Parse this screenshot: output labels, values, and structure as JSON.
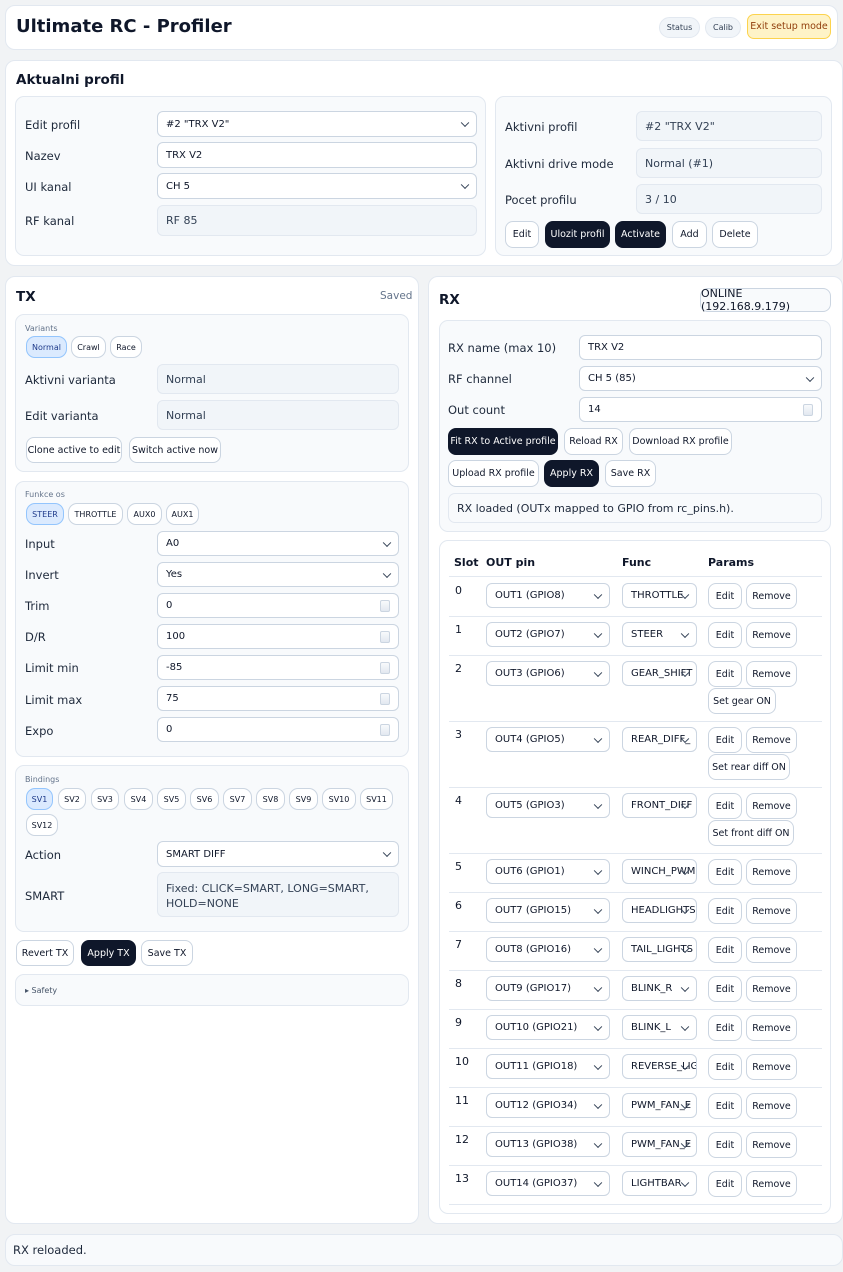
{
  "header": {
    "title": "Ultimate RC - Profiler",
    "badges": [
      "Status",
      "Calib"
    ],
    "exit_label": "Exit setup mode"
  },
  "profile": {
    "section_title": "Aktualni profil",
    "edit_profil_label": "Edit profil",
    "edit_profil_value": "#2 \"TRX V2\"",
    "nazev_label": "Nazev",
    "nazev_value": "TRX V2",
    "ui_kanal_label": "UI kanal",
    "ui_kanal_value": "CH 5",
    "rf_kanal_label": "RF kanal",
    "rf_kanal_value": "RF 85",
    "aktivni_profil_label": "Aktivni profil",
    "aktivni_profil_value": "#2 \"TRX V2\"",
    "drive_mode_label": "Aktivni drive mode",
    "drive_mode_value": "Normal (#1)",
    "pocet_label": "Pocet profilu",
    "pocet_value": "3 / 10",
    "buttons": {
      "edit": "Edit",
      "save": "Ulozit profil",
      "activate": "Activate",
      "add": "Add",
      "delete": "Delete"
    }
  },
  "tx": {
    "title": "TX",
    "saved": "Saved",
    "variants_label": "Variants",
    "variants": [
      "Normal",
      "Crawl",
      "Race"
    ],
    "aktivni_varianta_label": "Aktivni varianta",
    "aktivni_varianta_value": "Normal",
    "edit_varianta_label": "Edit varianta",
    "edit_varianta_value": "Normal",
    "clone_label": "Clone active to edit",
    "switch_label": "Switch active now",
    "funkce_label": "Funkce os",
    "axes": [
      "STEER",
      "THROTTLE",
      "AUX0",
      "AUX1"
    ],
    "fields": {
      "input": {
        "label": "Input",
        "value": "A0"
      },
      "invert": {
        "label": "Invert",
        "value": "Yes"
      },
      "trim": {
        "label": "Trim",
        "value": "0"
      },
      "dr": {
        "label": "D/R",
        "value": "100"
      },
      "limit_min": {
        "label": "Limit min",
        "value": "-85"
      },
      "limit_max": {
        "label": "Limit max",
        "value": "75"
      },
      "expo": {
        "label": "Expo",
        "value": "0"
      }
    },
    "bindings_label": "Bindings",
    "bindings": [
      "SV1",
      "SV2",
      "SV3",
      "SV4",
      "SV5",
      "SV6",
      "SV7",
      "SV8",
      "SV9",
      "SV10",
      "SV11",
      "SV12"
    ],
    "action_label": "Action",
    "action_value": "SMART DIFF",
    "smart_label": "SMART",
    "smart_line1": "Fixed: CLICK=SMART, LONG=SMART,",
    "smart_line2": "HOLD=NONE",
    "revert_label": "Revert TX",
    "apply_label": "Apply TX",
    "save_label": "Save TX",
    "safety_label": "▸ Safety"
  },
  "rx": {
    "title": "RX",
    "status": "ONLINE (192.168.9.179)",
    "name_label": "RX name (max 10)",
    "name_value": "TRX V2",
    "rf_label": "RF channel",
    "rf_value": "CH 5 (85)",
    "out_label": "Out count",
    "out_value": "14",
    "buttons": {
      "fit": "Fit RX to Active profile",
      "reload": "Reload RX",
      "download": "Download RX profile",
      "upload": "Upload RX profile",
      "apply": "Apply RX",
      "save": "Save RX"
    },
    "loaded_msg": "RX loaded (OUTx mapped to GPIO from rc_pins.h).",
    "table": {
      "headers": [
        "Slot",
        "OUT pin",
        "Func",
        "Params"
      ],
      "edit_label": "Edit",
      "remove_label": "Remove",
      "rows": [
        {
          "slot": "0",
          "pin": "OUT1 (GPIO8)",
          "func": "THROTTLE",
          "extra": ""
        },
        {
          "slot": "1",
          "pin": "OUT2 (GPIO7)",
          "func": "STEER",
          "extra": ""
        },
        {
          "slot": "2",
          "pin": "OUT3 (GPIO6)",
          "func": "GEAR_SHIFT",
          "extra": "Set gear ON"
        },
        {
          "slot": "3",
          "pin": "OUT4 (GPIO5)",
          "func": "REAR_DIFF_",
          "extra": "Set rear diff ON"
        },
        {
          "slot": "4",
          "pin": "OUT5 (GPIO3)",
          "func": "FRONT_DIFF",
          "extra": "Set front diff ON"
        },
        {
          "slot": "5",
          "pin": "OUT6 (GPIO1)",
          "func": "WINCH_PWM",
          "extra": ""
        },
        {
          "slot": "6",
          "pin": "OUT7 (GPIO15)",
          "func": "HEADLIGHTS",
          "extra": ""
        },
        {
          "slot": "7",
          "pin": "OUT8 (GPIO16)",
          "func": "TAIL_LIGHTS",
          "extra": ""
        },
        {
          "slot": "8",
          "pin": "OUT9 (GPIO17)",
          "func": "BLINK_R",
          "extra": ""
        },
        {
          "slot": "9",
          "pin": "OUT10 (GPIO21)",
          "func": "BLINK_L",
          "extra": ""
        },
        {
          "slot": "10",
          "pin": "OUT11 (GPIO18)",
          "func": "REVERSE_LIG",
          "extra": ""
        },
        {
          "slot": "11",
          "pin": "OUT12 (GPIO34)",
          "func": "PWM_FAN_E",
          "extra": ""
        },
        {
          "slot": "12",
          "pin": "OUT13 (GPIO38)",
          "func": "PWM_FAN_E",
          "extra": ""
        },
        {
          "slot": "13",
          "pin": "OUT14 (GPIO37)",
          "func": "LIGHTBAR",
          "extra": ""
        }
      ]
    }
  },
  "footer": {
    "message": "RX reloaded."
  }
}
